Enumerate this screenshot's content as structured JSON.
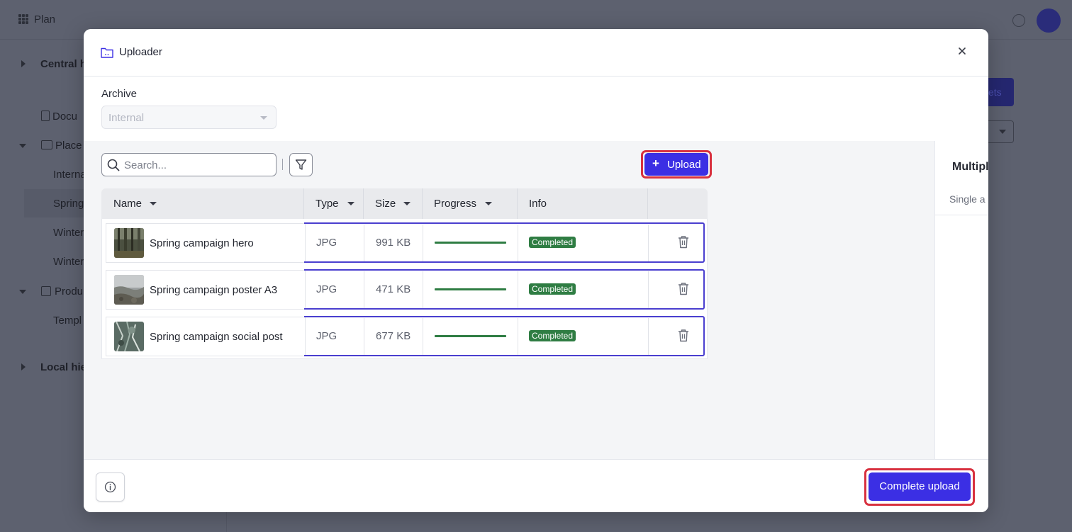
{
  "background": {
    "app_title": "Plan",
    "sidebar": [
      {
        "label": "Central h",
        "bold": true
      },
      {
        "label": "Docu"
      },
      {
        "label": "Place"
      },
      {
        "label": "Interna"
      },
      {
        "label": "Spring"
      },
      {
        "label": "Winter"
      },
      {
        "label": "Winter"
      },
      {
        "label": "Produ"
      },
      {
        "label": "Templ"
      },
      {
        "label": "Local hie",
        "bold": true
      }
    ],
    "button_label": "ets"
  },
  "modal": {
    "title": "Uploader",
    "archive": {
      "label": "Archive",
      "value": "Internal"
    },
    "search": {
      "placeholder": "Search...",
      "value": ""
    },
    "upload_label": "Upload",
    "columns": {
      "name": "Name",
      "type": "Type",
      "size": "Size",
      "progress": "Progress",
      "info": "Info"
    },
    "rows": [
      {
        "name": "Spring campaign hero",
        "type": "JPG",
        "size": "991 KB",
        "progress": 1.0,
        "status": "Completed"
      },
      {
        "name": "Spring campaign poster A3",
        "type": "JPG",
        "size": "471 KB",
        "progress": 1.0,
        "status": "Completed"
      },
      {
        "name": "Spring campaign social post",
        "type": "JPG",
        "size": "677 KB",
        "progress": 1.0,
        "status": "Completed"
      }
    ],
    "right_panel": {
      "title": "Multipl",
      "subtitle": "Single a"
    },
    "complete_label": "Complete upload"
  },
  "colors": {
    "accent": "#3b2fe4",
    "success": "#2f7d43",
    "highlight": "#d8313f"
  }
}
